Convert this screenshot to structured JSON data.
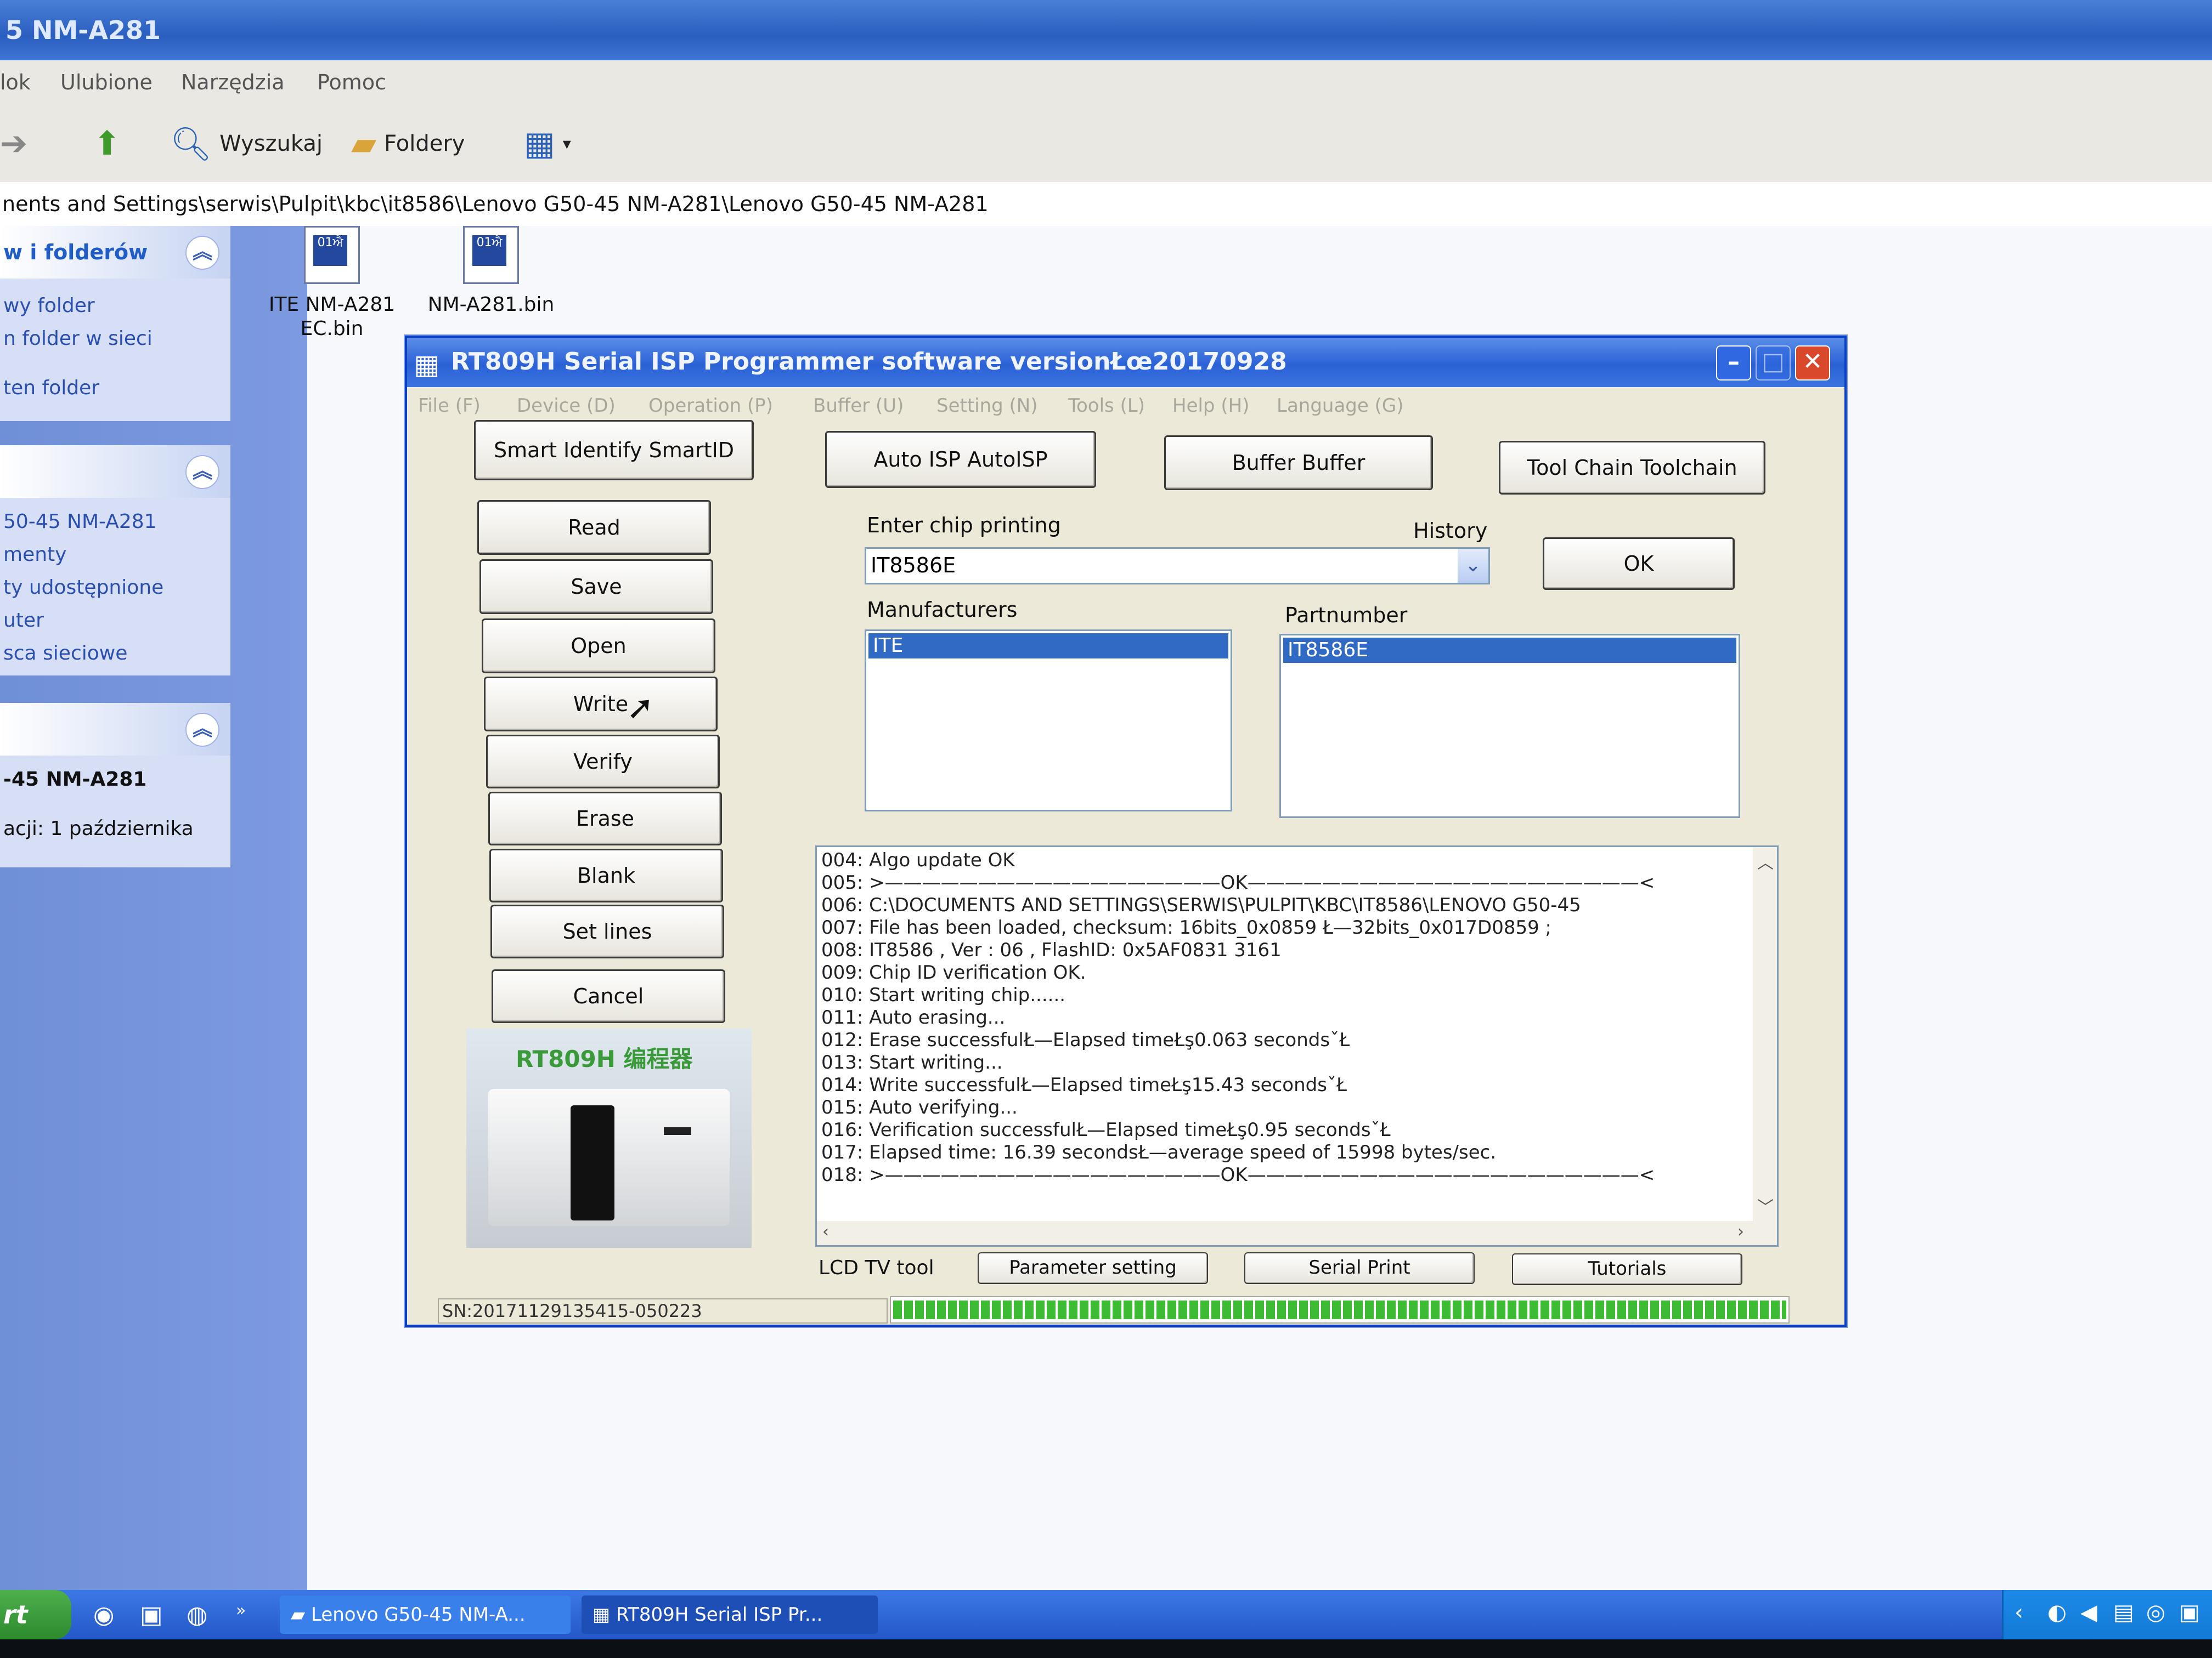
{
  "explorer": {
    "title": "5 NM-A281",
    "menu": [
      "lok",
      "Ulubione",
      "Narzędzia",
      "Pomoc"
    ],
    "toolbar": {
      "search_label": "Wyszukaj",
      "folders_label": "Foldery"
    },
    "address": "nents and Settings\\serwis\\Pulpit\\kbc\\it8586\\Lenovo G50-45 NM-A281\\Lenovo G50-45 NM-A281",
    "tasks_panel": {
      "title": "w i folderów",
      "items": [
        "wy folder",
        "n folder w sieci",
        "ten folder"
      ]
    },
    "places_panel": {
      "items": [
        "50-45 NM-A281",
        "menty",
        "ty udostępnione",
        "uter",
        "sca sieciowe"
      ]
    },
    "details_panel": {
      "name": "-45 NM-A281",
      "modified": "acji: 1 października"
    },
    "files": [
      {
        "name": "ITE NM-A281\nEC.bin"
      },
      {
        "name": "NM-A281.bin"
      }
    ]
  },
  "dialog": {
    "title": "RT809H Serial ISP Programmer software versionŁœ20170928",
    "menu": [
      "File (F)",
      "Device (D)",
      "Operation (P)",
      "Buffer (U)",
      "Setting (N)",
      "Tools (L)",
      "Help (H)",
      "Language (G)"
    ],
    "top_buttons": {
      "smart_id": "Smart Identify SmartID",
      "auto_isp": "Auto ISP AutoISP",
      "buffer": "Buffer Buffer",
      "toolchain": "Tool Chain Toolchain"
    },
    "side_buttons": [
      "Read",
      "Save",
      "Open",
      "Write",
      "Verify",
      "Erase",
      "Blank",
      "Set lines",
      "Cancel"
    ],
    "chip_label": "Enter chip printing",
    "history_label": "History",
    "chip_value": "IT8586E",
    "ok_label": "OK",
    "manufacturers_label": "Manufacturers",
    "manufacturer_selected": "ITE",
    "partnumber_label": "Partnumber",
    "partnumber_selected": "IT8586E",
    "log": [
      "004:  Algo update OK",
      "005:  >——————————————————OK—————————————————————<",
      "006:  C:\\DOCUMENTS AND SETTINGS\\SERWIS\\PULPIT\\KBC\\IT8586\\LENOVO G50-45",
      "007:  File has been loaded, checksum: 16bits_0x0859 Ł—32bits_0x017D0859 ;",
      "008:  IT8586 , Ver : 06 , FlashID: 0x5AF0831 3161",
      "009:  Chip ID verification OK.",
      "010:  Start writing chip......",
      "011:  Auto erasing...",
      "012:  Erase successfulŁ—Elapsed timeŁş0.063 secondsˇŁ",
      "013:  Start writing...",
      "014:  Write successfulŁ—Elapsed timeŁş15.43 secondsˇŁ",
      "015:  Auto verifying...",
      "016:  Verification successfulŁ—Elapsed timeŁş0.95 secondsˇŁ",
      "017:  Elapsed time: 16.39 secondsŁ—average speed of 15998 bytes/sec.",
      "018:  >——————————————————OK—————————————————————<"
    ],
    "bottom_label": "LCD TV tool",
    "bottom_buttons": [
      "Parameter setting",
      "Serial Print",
      "Tutorials"
    ],
    "logo_text": "RT809H 编程器",
    "serial": "SN:20171129135415-050223",
    "progress": 1.0
  },
  "taskbar": {
    "start": "rt",
    "tasks": [
      "Lenovo G50-45 NM-A...",
      "RT809H Serial ISP Pr..."
    ]
  },
  "colors": {
    "title_blue": "#2a61d6",
    "selection_blue": "#316ac5",
    "progress_green": "#3dbb32",
    "close_red": "#d9482a"
  }
}
